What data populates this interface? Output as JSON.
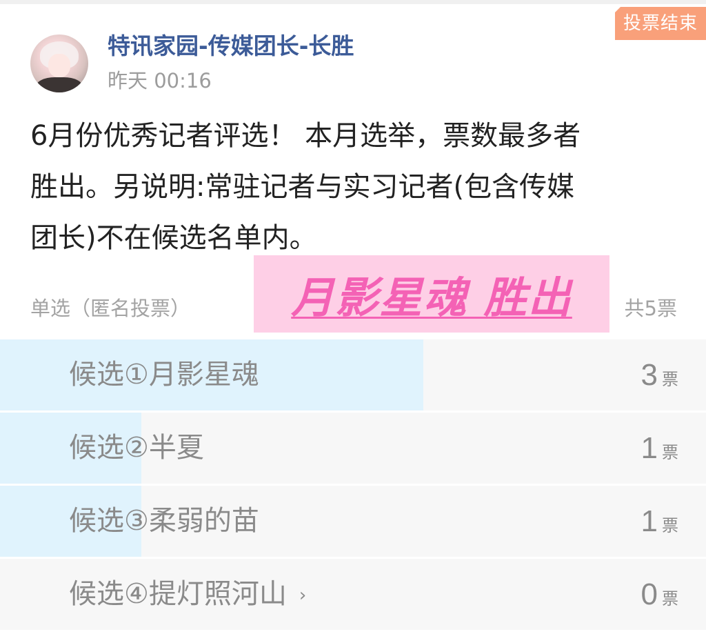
{
  "post": {
    "status_tag": "投票结束",
    "author": "特讯家园-传媒团长-长胜",
    "time": "昨天 00:16",
    "lines": [
      "6月份优秀记者评选！ 本月选举，票数最多者",
      "胜出。另说明:常驻记者与实习记者(包含传媒",
      "团长)不在候选名单内。"
    ]
  },
  "poll": {
    "type_label": "单选（匿名投票）",
    "total_label": "共5票",
    "winner_banner": "月影星魂 胜出",
    "unit": "票",
    "options": [
      {
        "label": "候选①月影星魂",
        "votes": "3",
        "fraction": 0.6
      },
      {
        "label": "候选②半夏",
        "votes": "1",
        "fraction": 0.2
      },
      {
        "label": "候选③柔弱的苗",
        "votes": "1",
        "fraction": 0.2
      },
      {
        "label": "候选④提灯照河山",
        "votes": "0",
        "fraction": 0.0,
        "trailing_icon": "chevron-right-icon",
        "trailing_glyph": "›"
      }
    ]
  },
  "colors": {
    "status_tag": "#f9a07a",
    "author": "#3c5b98",
    "bar_fill": "#e0f3fd",
    "banner_bg": "#fecfe6",
    "banner_text": "#f462b5"
  }
}
